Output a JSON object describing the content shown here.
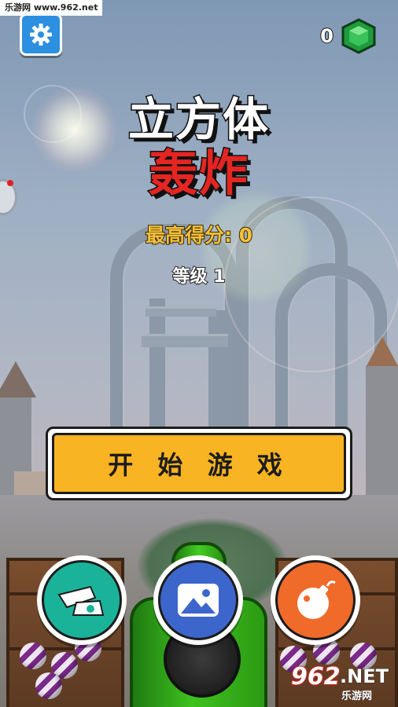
{
  "watermark": {
    "site_text": "乐游网 www.962.net"
  },
  "topbar": {
    "settings_icon": "gear-icon",
    "gem_count": "0",
    "gem_icon": "green-gem-icon"
  },
  "title": {
    "line1": "立方体",
    "line2": "轰炸"
  },
  "stats": {
    "best_score": "最高得分: 0",
    "level": "等级 1"
  },
  "start_button": {
    "label": "开 始 游 戏"
  },
  "bottom_buttons": [
    {
      "icon": "cannon-icon",
      "color": "#1ab39a"
    },
    {
      "icon": "landscape-image-icon",
      "color": "#3d66cc"
    },
    {
      "icon": "bomb-icon",
      "color": "#f06a2a"
    }
  ],
  "logo": {
    "number": "962",
    "net": ".NET",
    "sub": "乐游网"
  },
  "colors": {
    "title_red": "#e52521",
    "score_gold": "#f3c03a",
    "start_orange": "#f8b422",
    "settings_blue": "#2c8fe0"
  }
}
